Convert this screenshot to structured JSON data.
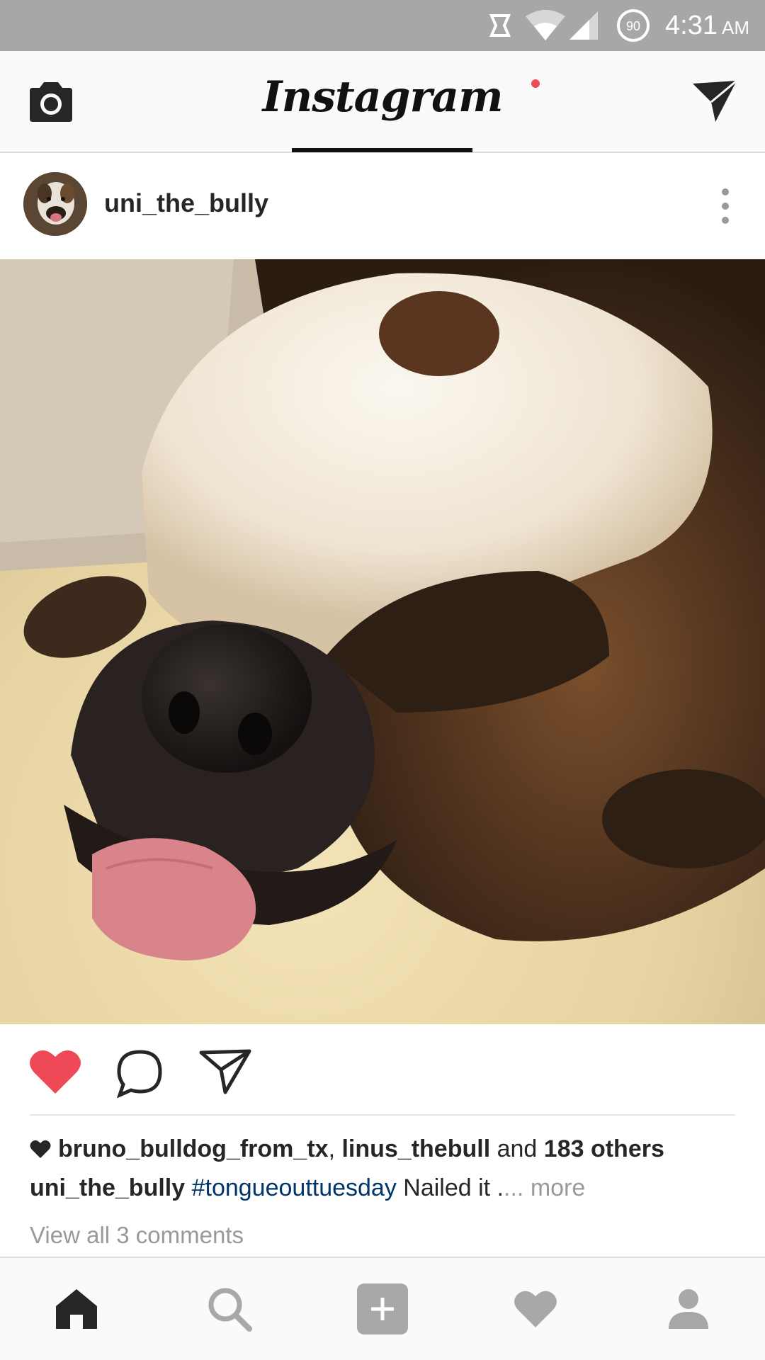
{
  "status_bar": {
    "time": "4:31",
    "ampm": "AM",
    "battery_level": "90",
    "icons": [
      "notification-icon",
      "wifi-icon",
      "cell-signal-icon",
      "battery-icon"
    ]
  },
  "app_bar": {
    "logo_text": "Instagram",
    "left_icon": "camera-icon",
    "right_icon": "direct-message-icon"
  },
  "post": {
    "username": "uni_the_bully",
    "likes": {
      "user1": "bruno_bulldog_from_tx",
      "separator": ", ",
      "user2": "linus_thebull",
      "and_text": " and ",
      "others": "183 others"
    },
    "caption": {
      "author": "uni_the_bully",
      "hashtag": "#tongueouttuesday",
      "text": " Nailed it .",
      "more": "... more"
    },
    "view_comments": "View all 3 comments",
    "liked": true,
    "like_color": "#ed4956"
  },
  "bottom_nav": {
    "items": [
      "home-icon",
      "search-icon",
      "add-post-icon",
      "activity-heart-icon",
      "profile-icon"
    ],
    "active": "home-icon",
    "has_notification": true
  }
}
